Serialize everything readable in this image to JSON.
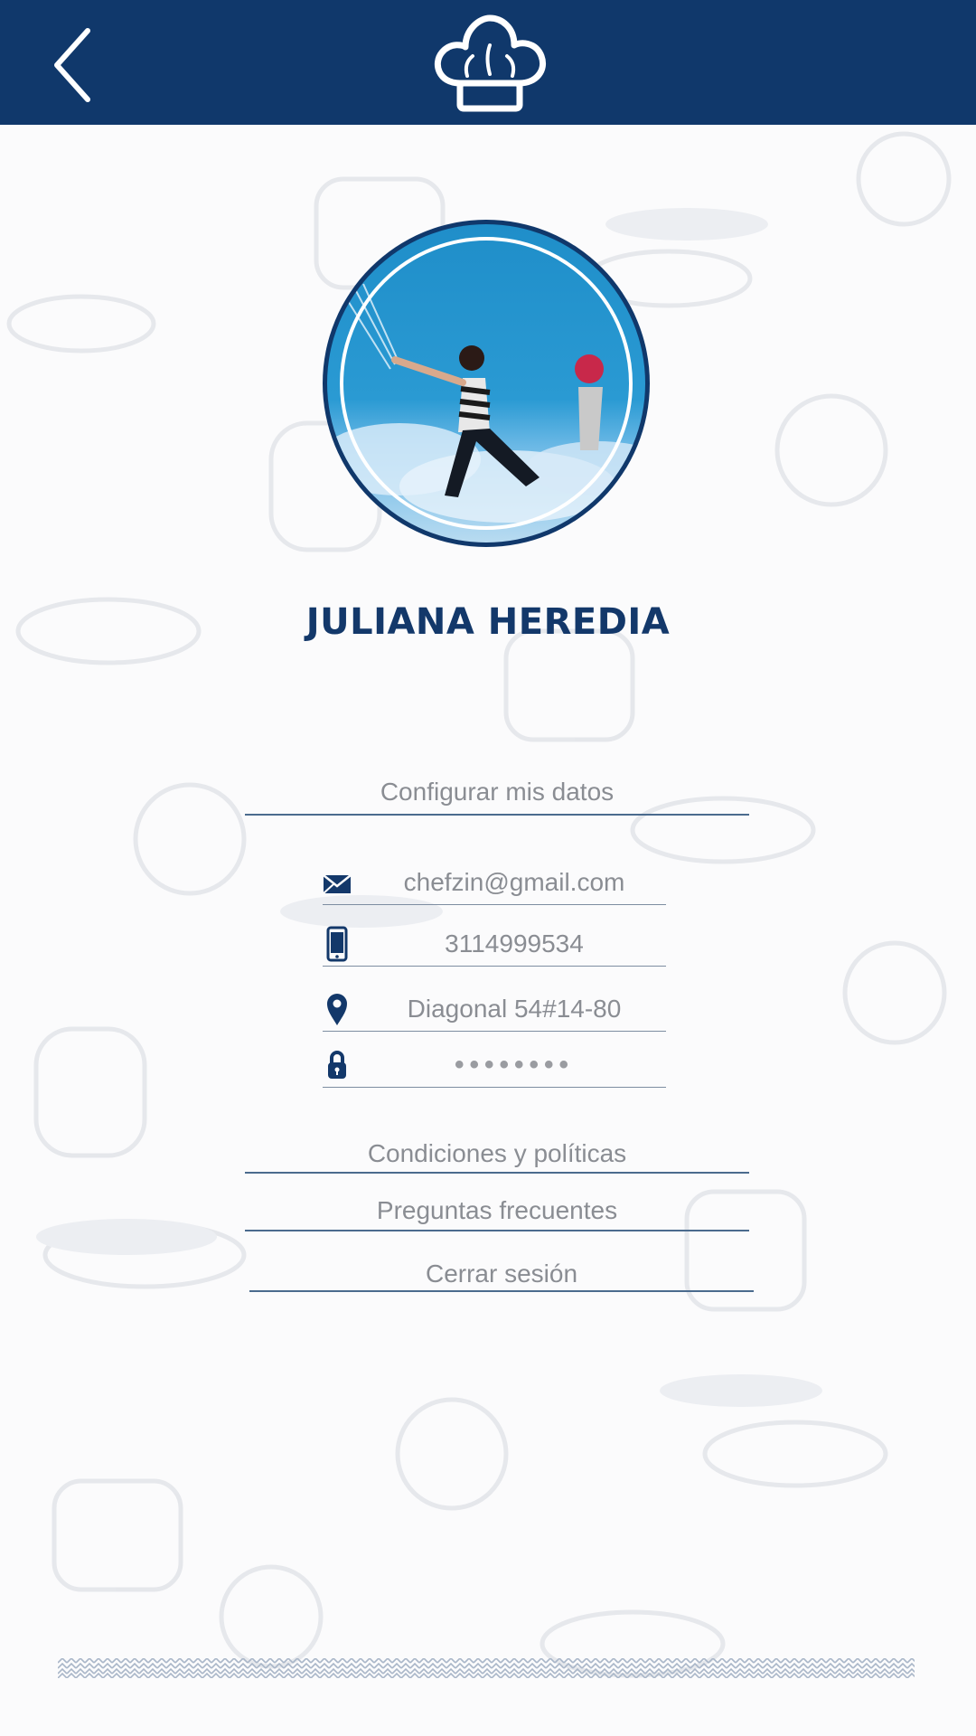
{
  "header": {
    "back_icon": "chevron-left-icon",
    "logo_icon": "chef-hat-icon",
    "bg_color": "#10386b"
  },
  "profile": {
    "name": "JULIANA HEREDIA"
  },
  "links": {
    "configure": "Configurar mis datos",
    "conditions": "Condiciones y políticas",
    "faq": "Preguntas frecuentes",
    "logout": "Cerrar sesión"
  },
  "fields": {
    "email": "chefzin@gmail.com",
    "phone": "3114999534",
    "address": "Diagonal 54#14-80",
    "password": "••••••••"
  },
  "colors": {
    "primary": "#10386b",
    "text_muted": "#8a8d93"
  }
}
